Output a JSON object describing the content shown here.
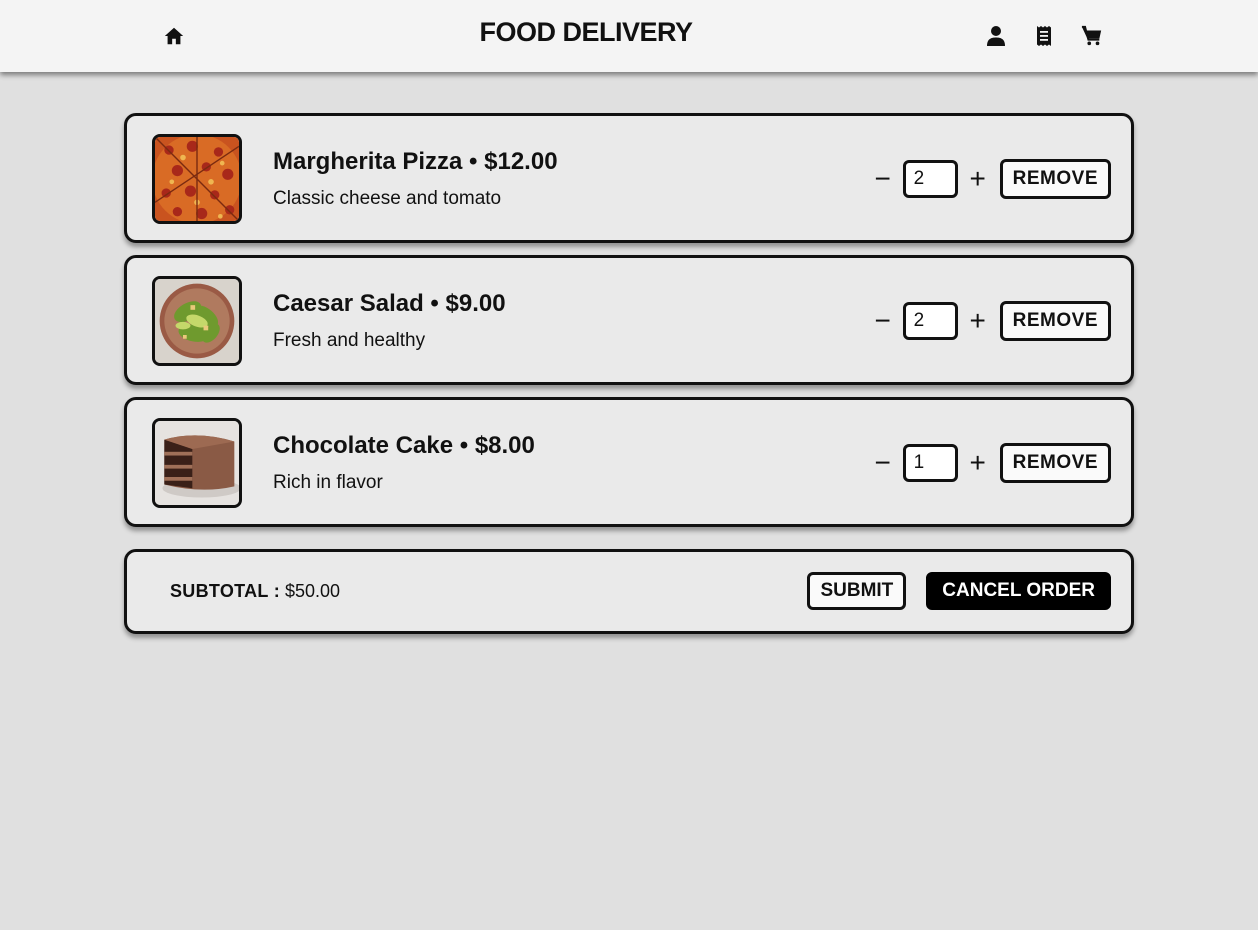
{
  "header": {
    "title": "FOOD DELIVERY",
    "icons": [
      "home-icon",
      "user-icon",
      "receipt-icon",
      "cart-icon"
    ]
  },
  "items": [
    {
      "name": "Margherita Pizza",
      "separator": " • ",
      "price": "$12.00",
      "description": "Classic cheese and tomato",
      "quantity": "2",
      "remove_label": "REMOVE",
      "decrement": "−",
      "increment": "+"
    },
    {
      "name": "Caesar Salad",
      "separator": " • ",
      "price": "$9.00",
      "description": "Fresh and healthy",
      "quantity": "2",
      "remove_label": "REMOVE",
      "decrement": "−",
      "increment": "+"
    },
    {
      "name": "Chocolate Cake",
      "separator": " • ",
      "price": "$8.00",
      "description": "Rich in flavor",
      "quantity": "1",
      "remove_label": "REMOVE",
      "decrement": "−",
      "increment": "+"
    }
  ],
  "summary": {
    "subtotal_label": "SUBTOTAL :",
    "subtotal_value": "$50.00",
    "submit_label": "SUBMIT",
    "cancel_label": "CANCEL ORDER"
  },
  "colors": {
    "background": "#e0e0e0",
    "card": "#eaeaea",
    "header": "#f4f4f4",
    "accent": "#000000"
  }
}
